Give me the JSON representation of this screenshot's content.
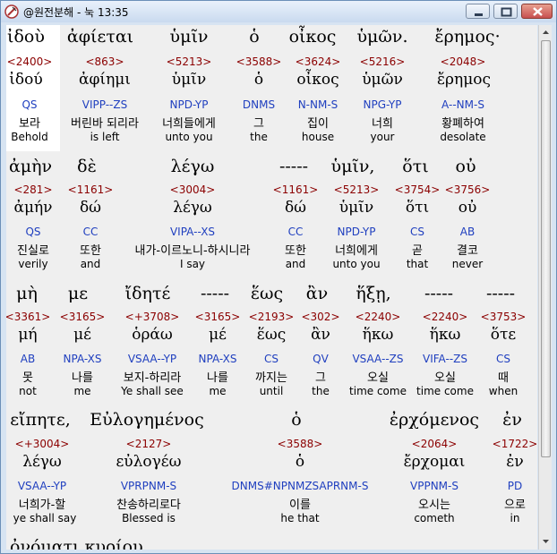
{
  "window": {
    "title": "@원전분해 - 눅 13:35",
    "colors": {
      "titlebar": "#c9daef",
      "content_bg": "#efefef",
      "strong_num": "#8b0000",
      "morph_code": "#1f3fbf"
    }
  },
  "rows": [
    {
      "greek": [
        "ἰδοὺ",
        "ἀφίεται",
        "ὑμῖν",
        "ὁ",
        "οἶκος",
        "ὑμῶν.",
        "ἔρημος·"
      ],
      "cells": [
        {
          "num": "<2400>",
          "lex": "ἰδού",
          "code": "QS",
          "kor": "보라",
          "eng": "Behold"
        },
        {
          "num": "<863>",
          "lex": "ἀφίημι",
          "code": "VIPP--ZS",
          "kor": "버린바 되리라",
          "eng": "is left"
        },
        {
          "num": "<5213>",
          "lex": "ὑμῖν",
          "code": "NPD-YP",
          "kor": "너희들에게",
          "eng": "unto you"
        },
        {
          "num": "<3588>",
          "lex": "ὁ",
          "code": "DNMS",
          "kor": "그",
          "eng": "the"
        },
        {
          "num": "<3624>",
          "lex": "οἶκος",
          "code": "N-NM-S",
          "kor": "집이",
          "eng": "house"
        },
        {
          "num": "<5216>",
          "lex": "ὑμῶν",
          "code": "NPG-YP",
          "kor": "너희",
          "eng": "your"
        },
        {
          "num": "<2048>",
          "lex": "ἔρημος",
          "code": "A--NM-S",
          "kor": "황폐하여",
          "eng": "desolate"
        }
      ]
    },
    {
      "greek": [
        "ἀμὴν",
        "δὲ",
        "λέγω",
        "-----",
        "ὑμῖν,",
        "ὅτι",
        "οὐ"
      ],
      "cells": [
        {
          "num": "<281>",
          "lex": "ἀμήν",
          "code": "QS",
          "kor": "진실로",
          "eng": "verily"
        },
        {
          "num": "<1161>",
          "lex": "δώ",
          "code": "CC",
          "kor": "또한",
          "eng": "and"
        },
        {
          "num": "<3004>",
          "lex": "λέγω",
          "code": "VIPA--XS",
          "kor": "내가-이르노니-하시니라",
          "eng": "I say"
        },
        {
          "num": "<1161>",
          "lex": "δώ",
          "code": "CC",
          "kor": "또한",
          "eng": "and"
        },
        {
          "num": "<5213>",
          "lex": "ὑμῖν",
          "code": "NPD-YP",
          "kor": "너희에게",
          "eng": "unto you"
        },
        {
          "num": "<3754>",
          "lex": "ὅτι",
          "code": "CS",
          "kor": "곧",
          "eng": "that"
        },
        {
          "num": "<3756>",
          "lex": "οὐ",
          "code": "AB",
          "kor": "결코",
          "eng": "never"
        }
      ]
    },
    {
      "greek": [
        "μὴ",
        "με",
        "ἴδητέ",
        "-----",
        "ἕως",
        "ἂν",
        "ἥξῃ,",
        "-----",
        "-----"
      ],
      "cells": [
        {
          "num": "<3361>",
          "lex": "μή",
          "code": "AB",
          "kor": "못",
          "eng": "not"
        },
        {
          "num": "<3165>",
          "lex": "μέ",
          "code": "NPA-XS",
          "kor": "나를",
          "eng": "me"
        },
        {
          "num": "<+3708>",
          "lex": "ὁράω",
          "code": "VSAA--YP",
          "kor": "보지-하리라",
          "eng": "Ye shall see"
        },
        {
          "num": "<3165>",
          "lex": "μέ",
          "code": "NPA-XS",
          "kor": "나를",
          "eng": "me"
        },
        {
          "num": "<2193>",
          "lex": "ἕως",
          "code": "CS",
          "kor": "까지는",
          "eng": "until"
        },
        {
          "num": "<302>",
          "lex": "ἂν",
          "code": "QV",
          "kor": "그",
          "eng": "the"
        },
        {
          "num": "<2240>",
          "lex": "ἥκω",
          "code": "VSAA--ZS",
          "kor": "오실",
          "eng": "time come"
        },
        {
          "num": "<2240>",
          "lex": "ἥκω",
          "code": "VIFA--ZS",
          "kor": "오실",
          "eng": "time come"
        },
        {
          "num": "<3753>",
          "lex": "ὅτε",
          "code": "CS",
          "kor": "때",
          "eng": "when"
        }
      ]
    },
    {
      "greek": [
        "εἴπητε,",
        "Εὐλογημένος",
        "ὁ",
        "ἐρχόμενος",
        "ἐν"
      ],
      "cells": [
        {
          "num": "<+3004>",
          "lex": "λέγω",
          "code": "VSAA--YP",
          "kor": "너희가-할",
          "eng": "ye shall say"
        },
        {
          "num": "<2127>",
          "lex": "εὐλογέω",
          "code": "VPRPNM-S",
          "kor": "찬송하리로다",
          "eng": "Blessed is"
        },
        {
          "num": "<3588>",
          "lex": "ὁ",
          "code": "DNMS#NPNMZSAPRNM-S",
          "kor": "이를",
          "eng": "he that"
        },
        {
          "num": "<2064>",
          "lex": "ἔρχομαι",
          "code": "VPPNM-S",
          "kor": "오시는",
          "eng": "cometh"
        },
        {
          "num": "<1722>",
          "lex": "ἐν",
          "code": "PD",
          "kor": "으로",
          "eng": "in"
        }
      ]
    }
  ],
  "cutoff_line": "ὀνόματι κυρίου."
}
